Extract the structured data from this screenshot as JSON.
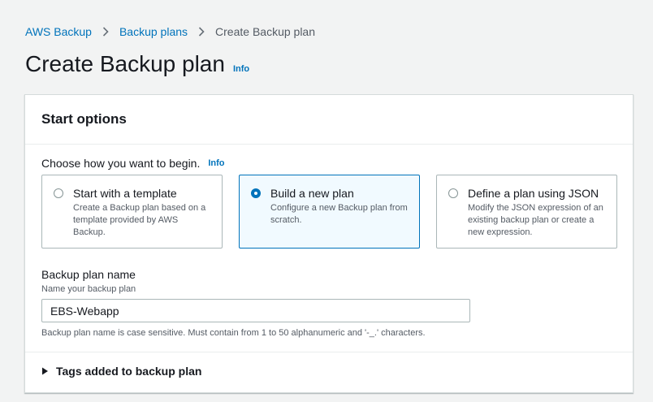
{
  "breadcrumb": {
    "items": [
      "AWS Backup",
      "Backup plans"
    ],
    "current": "Create Backup plan"
  },
  "page": {
    "title": "Create Backup plan",
    "info": "Info"
  },
  "start_options": {
    "title": "Start options",
    "prompt": "Choose how you want to begin.",
    "info": "Info",
    "options": [
      {
        "title": "Start with a template",
        "description": "Create a Backup plan based on a template provided by AWS Backup.",
        "selected": false
      },
      {
        "title": "Build a new plan",
        "description": "Configure a new Backup plan from scratch.",
        "selected": true
      },
      {
        "title": "Define a plan using JSON",
        "description": "Modify the JSON expression of an existing backup plan or create a new expression.",
        "selected": false
      }
    ]
  },
  "plan_name": {
    "label": "Backup plan name",
    "sublabel": "Name your backup plan",
    "value": "EBS-Webapp",
    "hint": "Backup plan name is case sensitive. Must contain from 1 to 50 alphanumeric and '-_.' characters."
  },
  "tags": {
    "label": "Tags added to backup plan",
    "icon": "caret-right-icon"
  },
  "colors": {
    "link": "#0073bb",
    "selected_border": "#0073bb",
    "selected_bg": "#f1faff"
  }
}
